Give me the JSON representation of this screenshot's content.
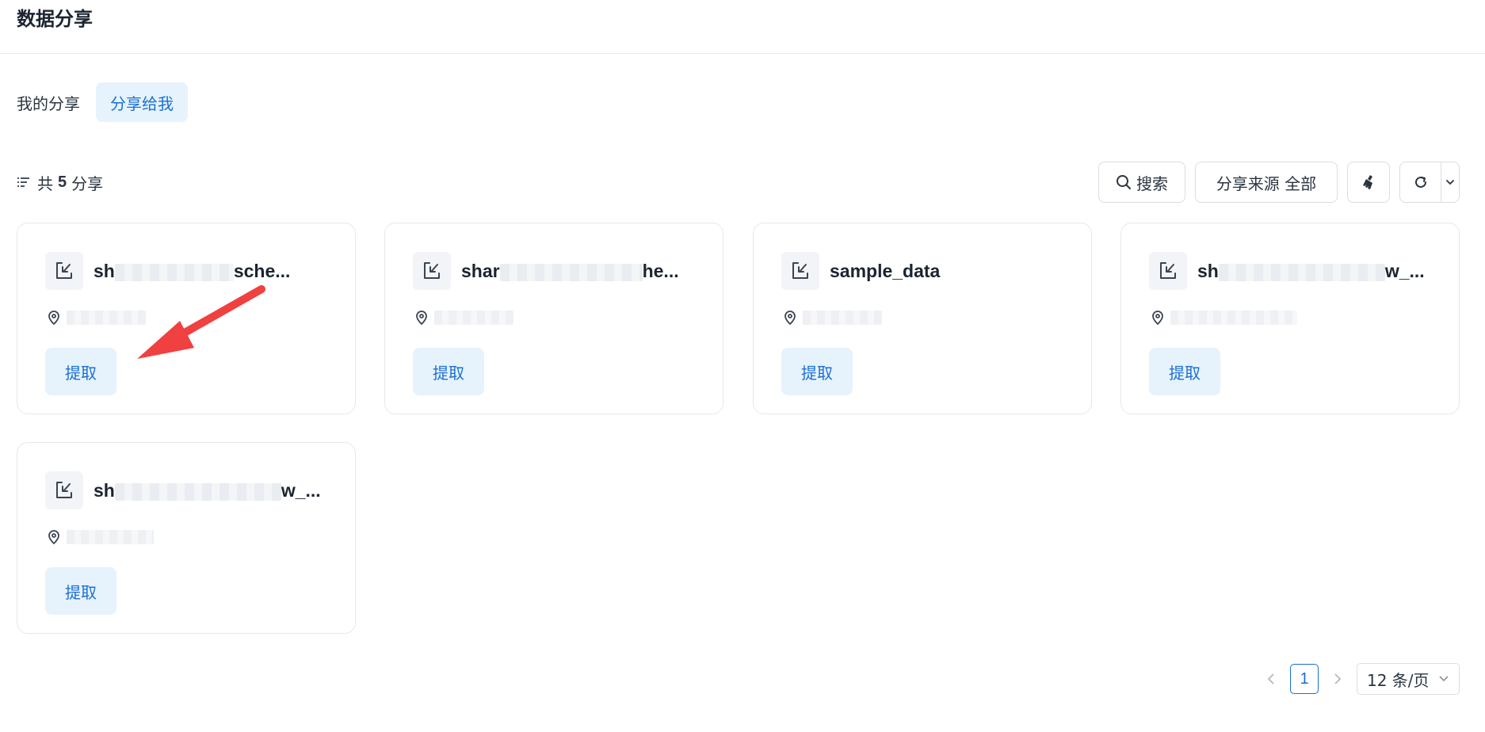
{
  "page": {
    "title": "数据分享"
  },
  "tabs": [
    {
      "label": "我的分享",
      "active": false
    },
    {
      "label": "分享给我",
      "active": true
    }
  ],
  "summary": {
    "prefix": "共",
    "count": "5",
    "suffix": "分享"
  },
  "toolbar": {
    "search_label": "搜索",
    "source_label": "分享来源 全部",
    "icons": [
      "search-icon",
      "broom-icon",
      "refresh-icon",
      "chevron-down-icon"
    ]
  },
  "cards": [
    {
      "name_start": "sh",
      "name_end": "sche...",
      "action": "提取"
    },
    {
      "name_start": "shar",
      "name_end": "he...",
      "action": "提取"
    },
    {
      "name": "sample_data",
      "action": "提取"
    },
    {
      "name_start": "sh",
      "name_end": "w_...",
      "action": "提取"
    },
    {
      "name_start": "sh",
      "name_end": "w_...",
      "action": "提取"
    }
  ],
  "pagination": {
    "current": "1",
    "page_size": "12 条/页"
  },
  "colors": {
    "accent": "#1b6fd3",
    "accent_bg": "#e6f3fd",
    "arrow": "#f04040"
  }
}
